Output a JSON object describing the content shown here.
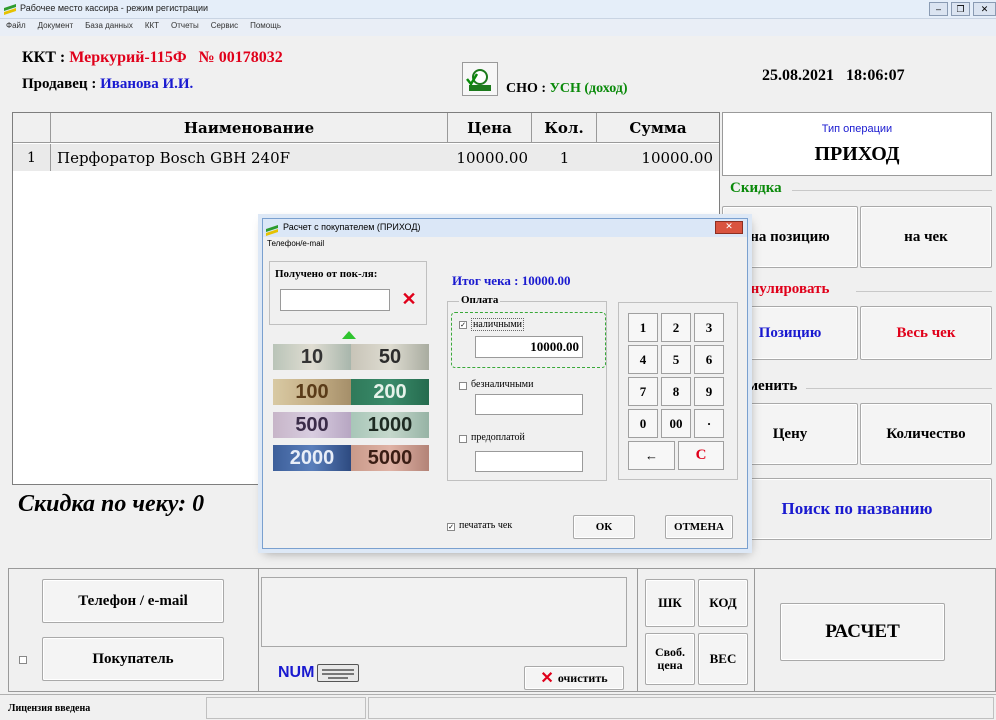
{
  "window": {
    "title": "Рабочее место кассира - режим регистрации",
    "menu": [
      "Файл",
      "Документ",
      "База данных",
      "ККТ",
      "Отчеты",
      "Сервис",
      "Помощь"
    ]
  },
  "header": {
    "kkt_label": "ККТ :",
    "kkt_value": "Меркурий-115Ф   № 00178032",
    "seller_label": "Продавец :",
    "seller_value": "Иванова И.И.",
    "sno_label": "СНО :",
    "sno_value": "УСН (доход)",
    "datetime": "25.08.2021   18:06:07"
  },
  "table": {
    "columns": [
      "Наименование",
      "Цена",
      "Кол.",
      "Сумма"
    ],
    "rows": [
      {
        "num": "1",
        "name": "Перфоратор Bosch GBH 240F",
        "price": "10000.00",
        "qty": "1",
        "sum": "10000.00"
      }
    ]
  },
  "right_panel": {
    "op_type_label": "Тип операции",
    "op_type_value": "ПРИХОД",
    "discount_group": "Скидка",
    "discount_position": "на позицию",
    "discount_check": "на чек",
    "cancel_group": "ннулировать",
    "cancel_position": "Позицию",
    "cancel_check": "Весь чек",
    "change_group": "зменить",
    "change_price": "Цену",
    "change_qty": "Количество",
    "search_by_name": "Поиск по названию"
  },
  "discount_line": "Скидка по чеку: 0",
  "bottom": {
    "phone_email": "Телефон / e-mail",
    "buyer": "Покупатель",
    "num_label": "NUM",
    "clear": "очистить",
    "shk": "ШК",
    "kod": "КОД",
    "free_price": "Своб. цена",
    "weight": "ВЕС",
    "payment": "РАСЧЕТ"
  },
  "status": {
    "license": "Лицензия введена"
  },
  "dialog": {
    "title": "Расчет с покупателем (ПРИХОД)",
    "subtitle": "Телефон/e-mail",
    "received_label": "Получено от пок-ля:",
    "received_value": "",
    "total_label": "Итог чека : 10000.00",
    "payment_group": "Оплата",
    "cash_label": "наличными",
    "cash_value": "10000.00",
    "card_label": "безналичными",
    "card_value": "",
    "prepay_label": "предоплатой",
    "prepay_value": "",
    "print_check": "печатать чек",
    "ok": "ОК",
    "cancel": "ОТМЕНА",
    "bills": [
      "10",
      "50",
      "100",
      "200",
      "500",
      "1000",
      "2000",
      "5000"
    ],
    "keypad": [
      "1",
      "2",
      "3",
      "4",
      "5",
      "6",
      "7",
      "8",
      "9",
      "0",
      "00",
      "·",
      "←",
      "С"
    ]
  },
  "colors": {
    "red": "#e0001a",
    "blue": "#1a1ad0",
    "green": "#0a8a0a",
    "dialog_border": "#7aa0cf"
  }
}
